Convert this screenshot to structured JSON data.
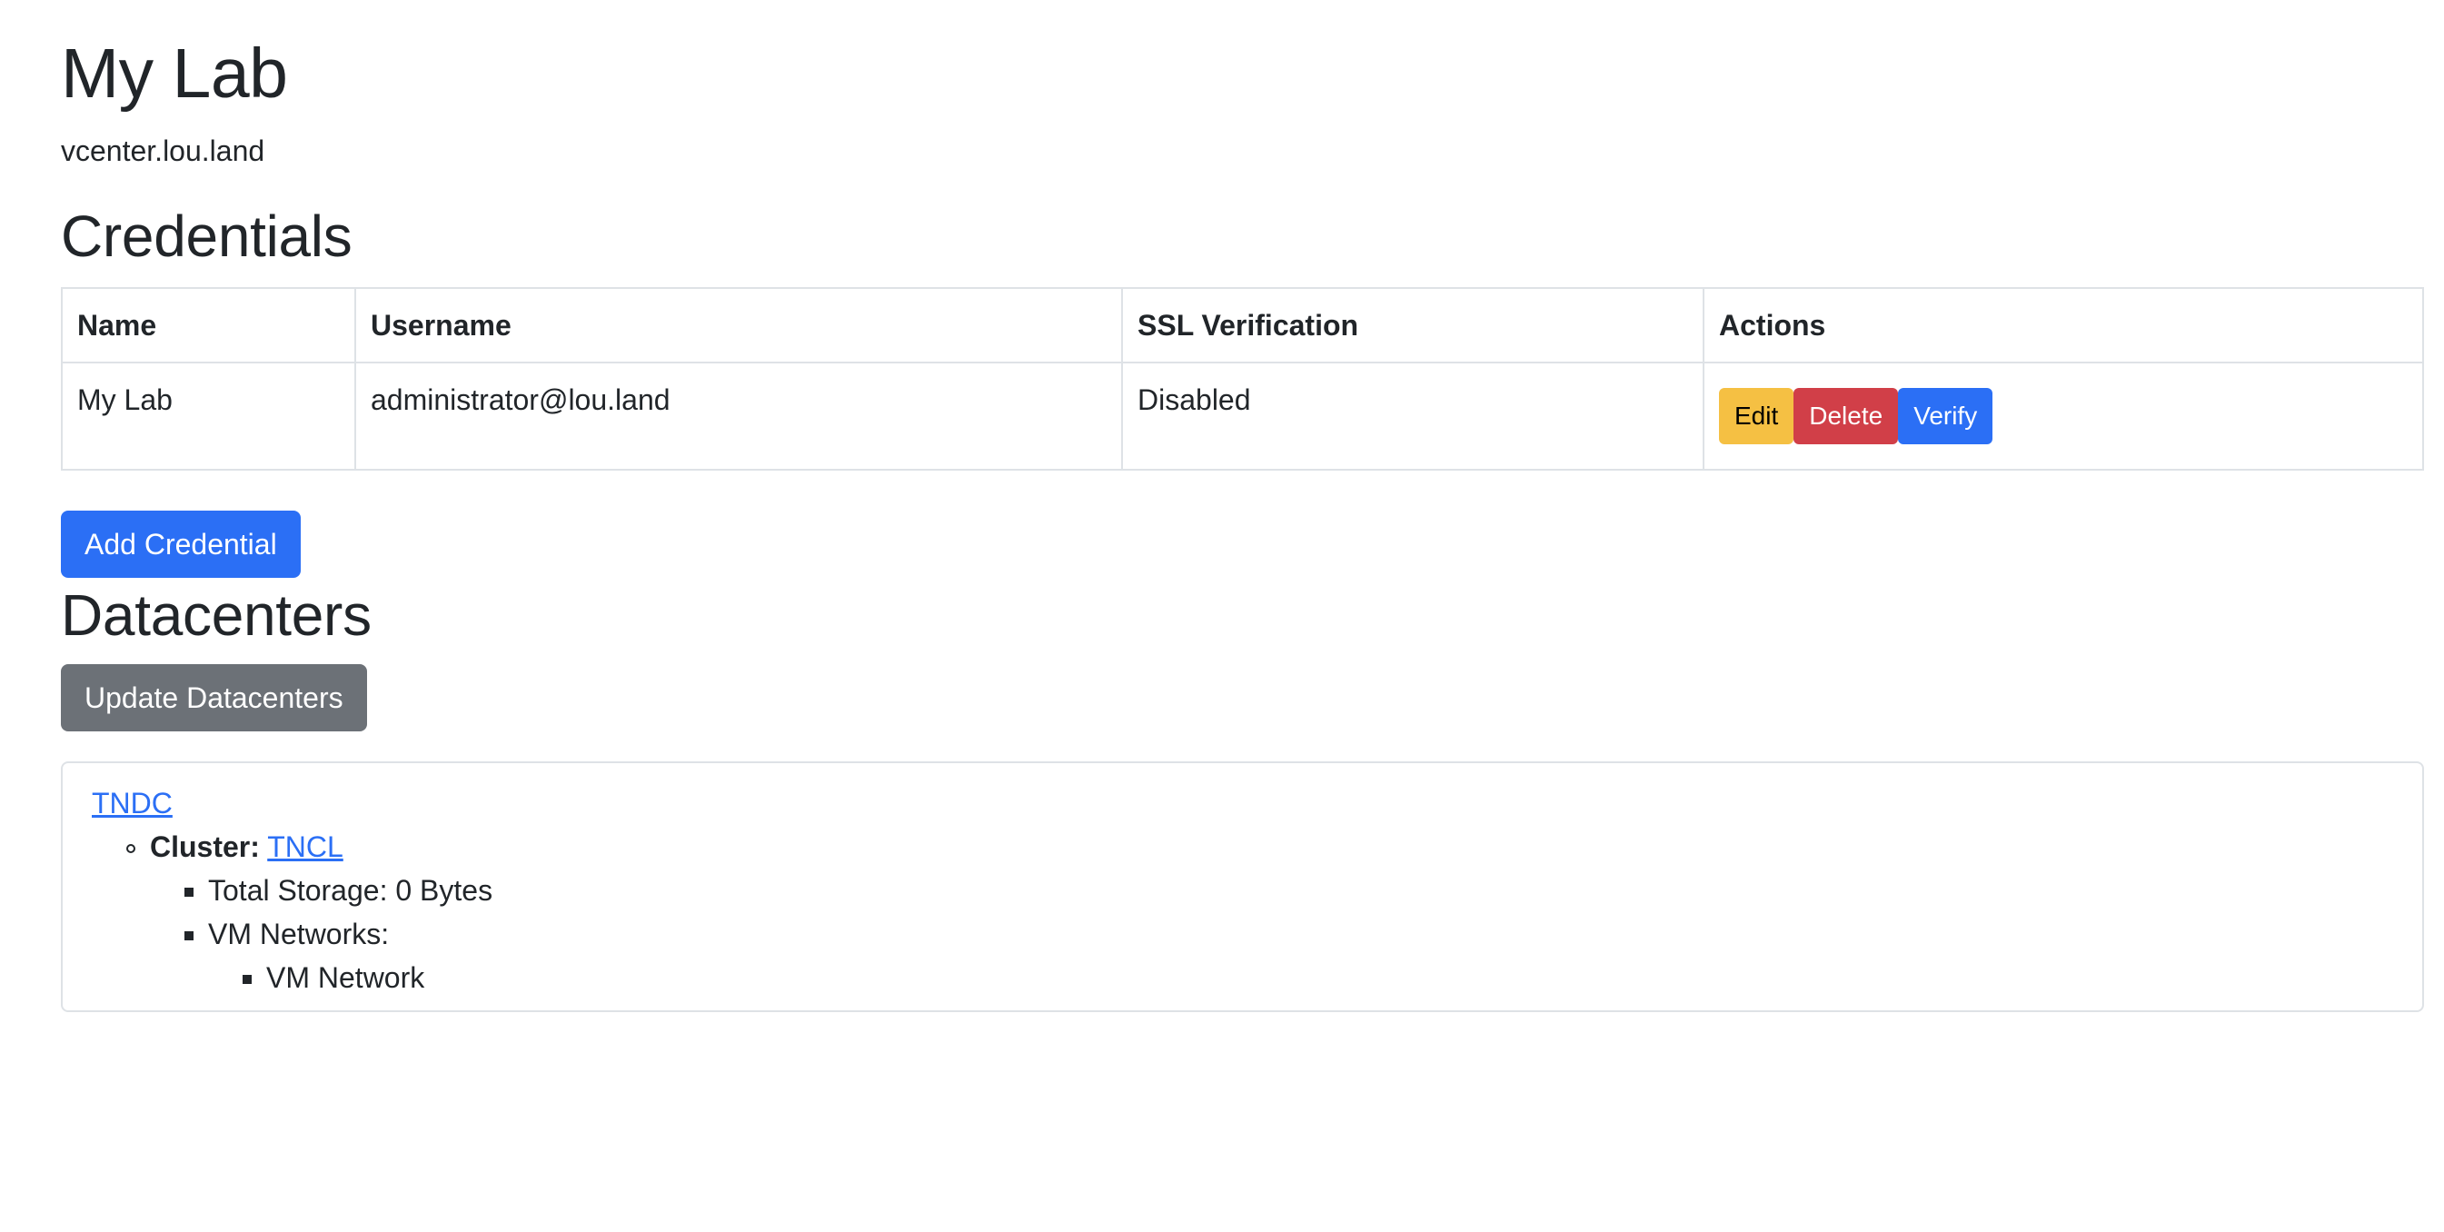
{
  "page": {
    "title": "My Lab",
    "host": "vcenter.lou.land"
  },
  "credentials": {
    "heading": "Credentials",
    "columns": [
      "Name",
      "Username",
      "SSL Verification",
      "Actions"
    ],
    "rows": [
      {
        "name": "My Lab",
        "username": "administrator@lou.land",
        "ssl": "Disabled",
        "actions": {
          "edit": "Edit",
          "delete": "Delete",
          "verify": "Verify"
        }
      }
    ],
    "add_button": "Add Credential"
  },
  "datacenters": {
    "heading": "Datacenters",
    "update_button": "Update Datacenters",
    "items": [
      {
        "name": "TNDC",
        "cluster_label": "Cluster:",
        "cluster_name": "TNCL",
        "storage_text": "Total Storage: 0 Bytes",
        "vm_networks_label": "VM Networks:",
        "vm_networks": [
          "VM Network"
        ]
      }
    ]
  },
  "colors": {
    "primary": "#2b6ff5",
    "warning": "#f5c043",
    "danger": "#d13f48",
    "secondary": "#6c7177"
  }
}
